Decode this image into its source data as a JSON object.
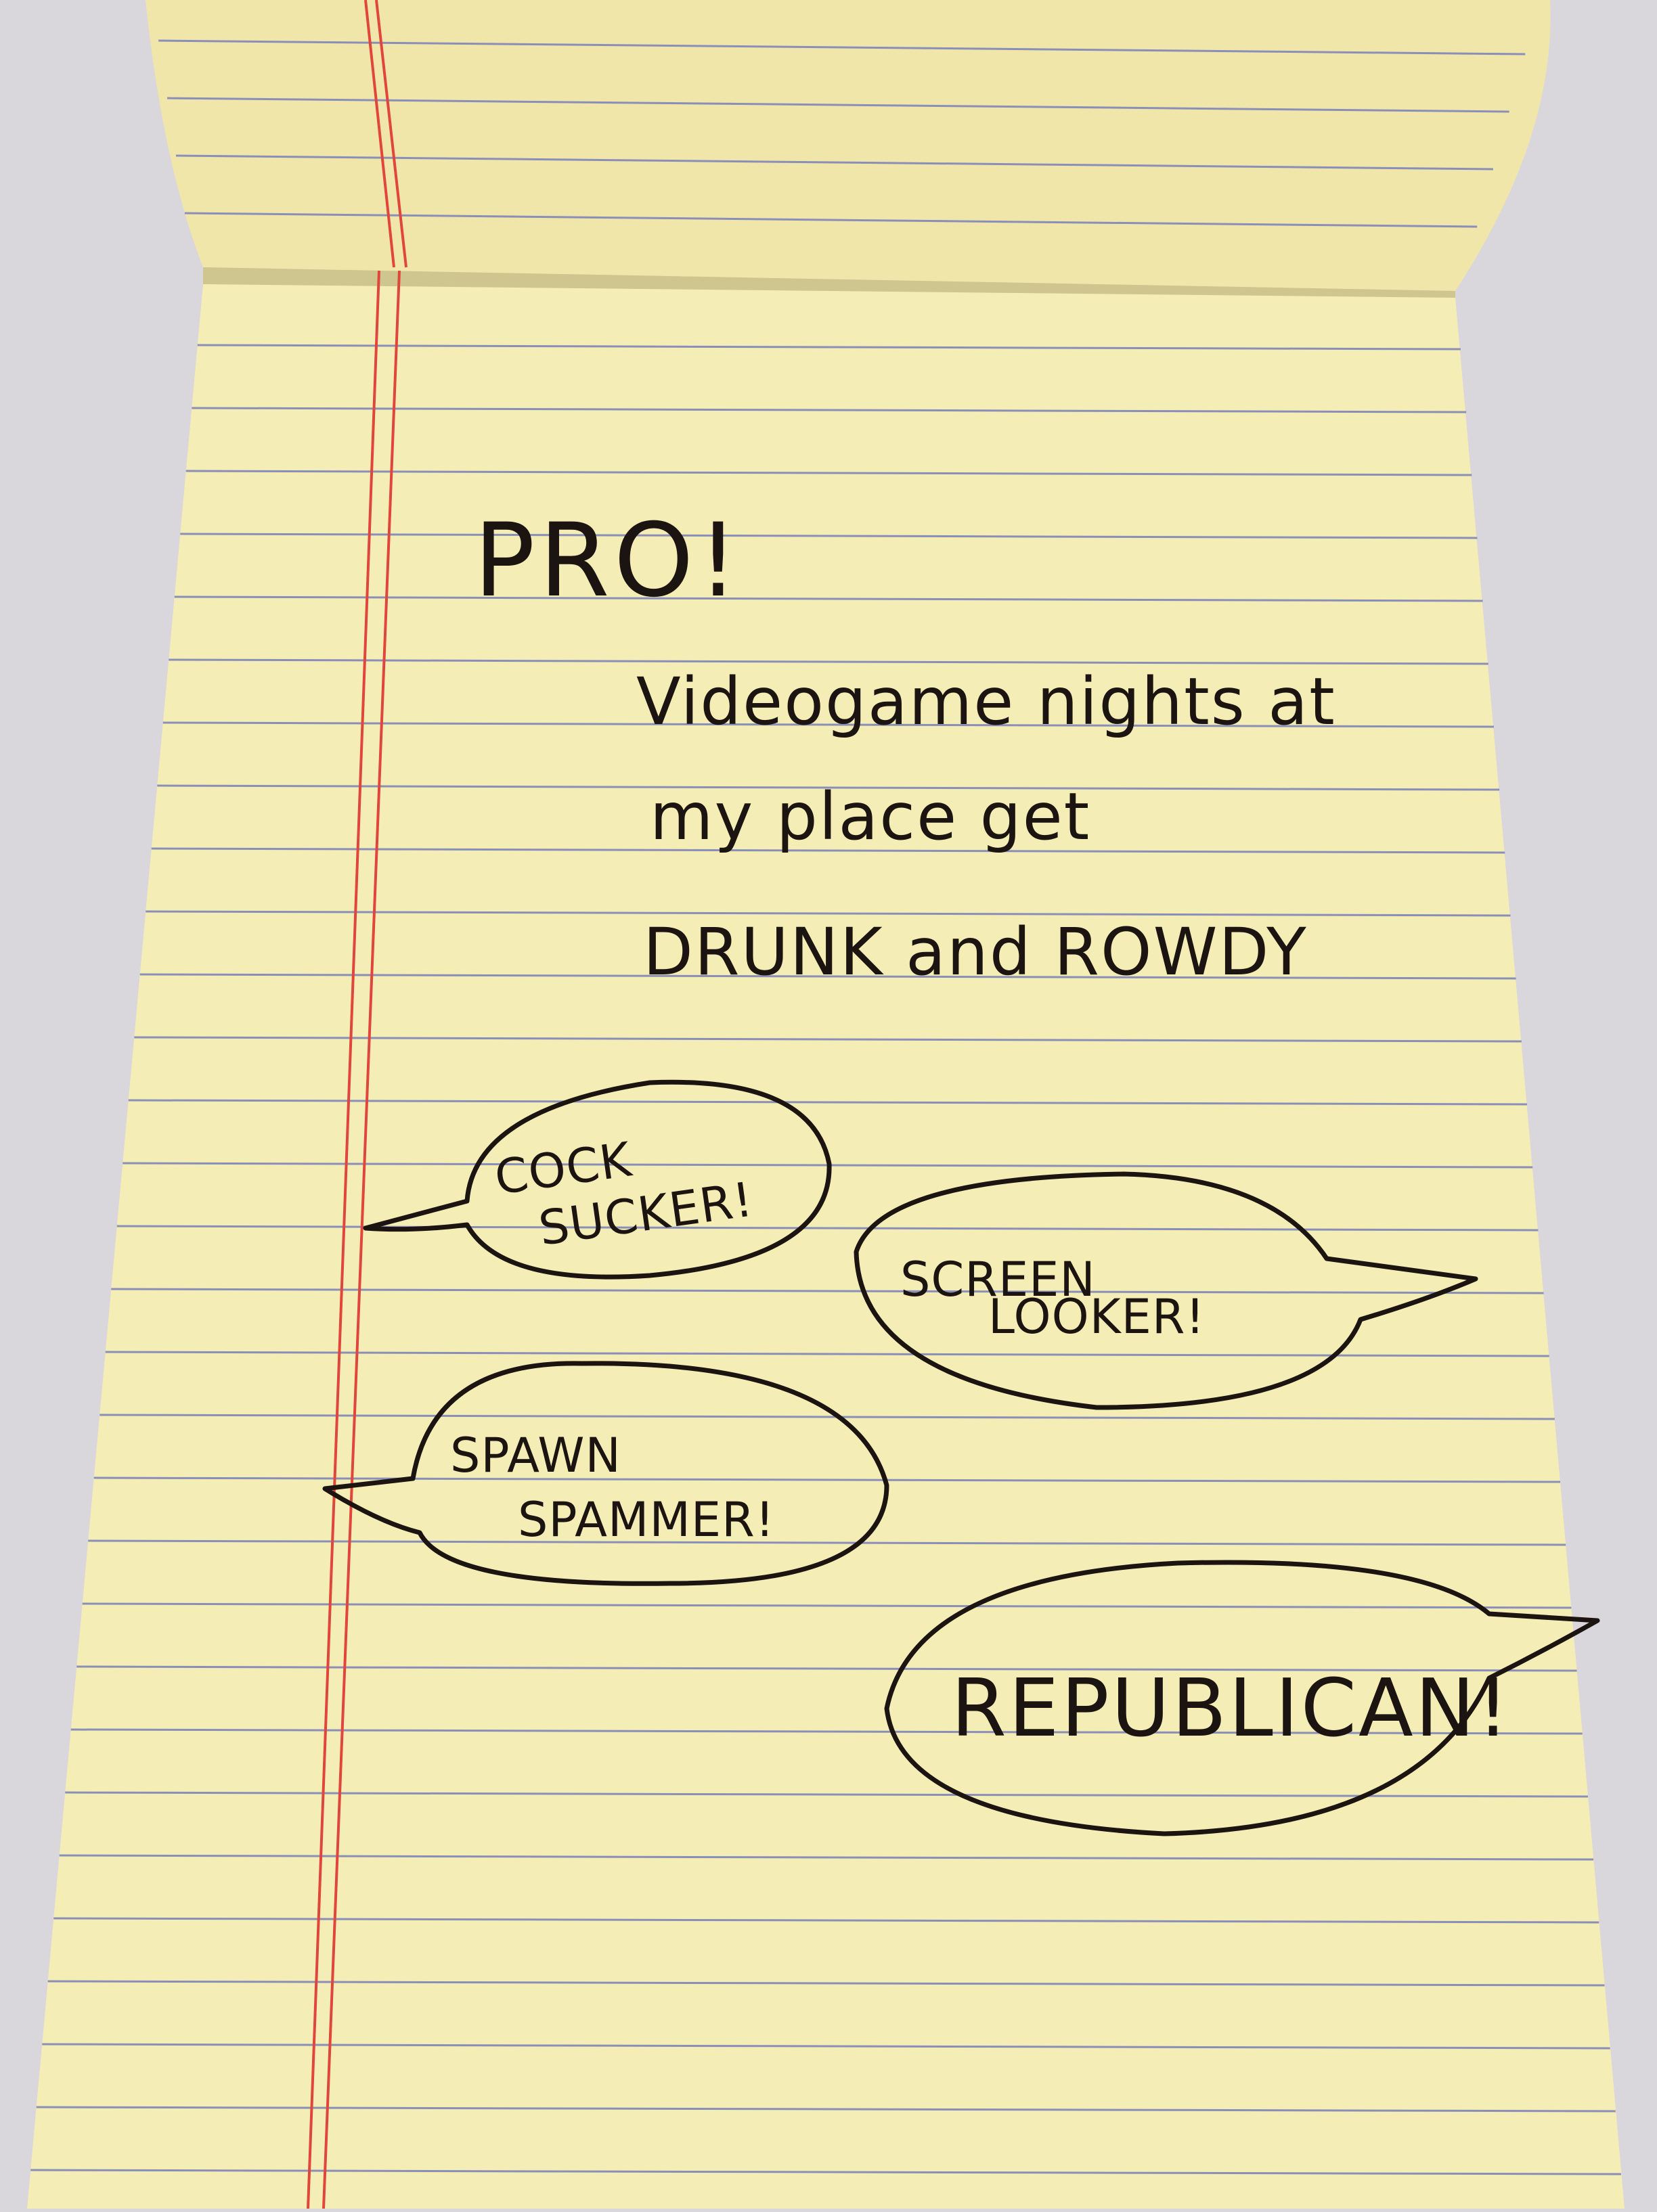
{
  "scene": {
    "subject": "yellow legal pad with handwritten note and speech bubbles",
    "colors": {
      "background": "#d9d6dc",
      "paper": "#f5edb6",
      "paper_shadow": "#e7dc9d",
      "rule_line": "#8a8fb8",
      "margin_line": "#e0463c",
      "ink": "#1c1410"
    }
  },
  "note": {
    "heading": "PRO!",
    "lines": [
      "Videogame nights at",
      "my place get",
      "DRUNK and ROWDY"
    ]
  },
  "bubbles": [
    {
      "lines": [
        "COCK",
        "SUCKER!"
      ]
    },
    {
      "lines": [
        "SCREEN",
        "LOOKER!"
      ]
    },
    {
      "lines": [
        "SPAWN",
        "SPAMMER!"
      ]
    },
    {
      "lines": [
        "REPUBLICAN!"
      ]
    }
  ]
}
